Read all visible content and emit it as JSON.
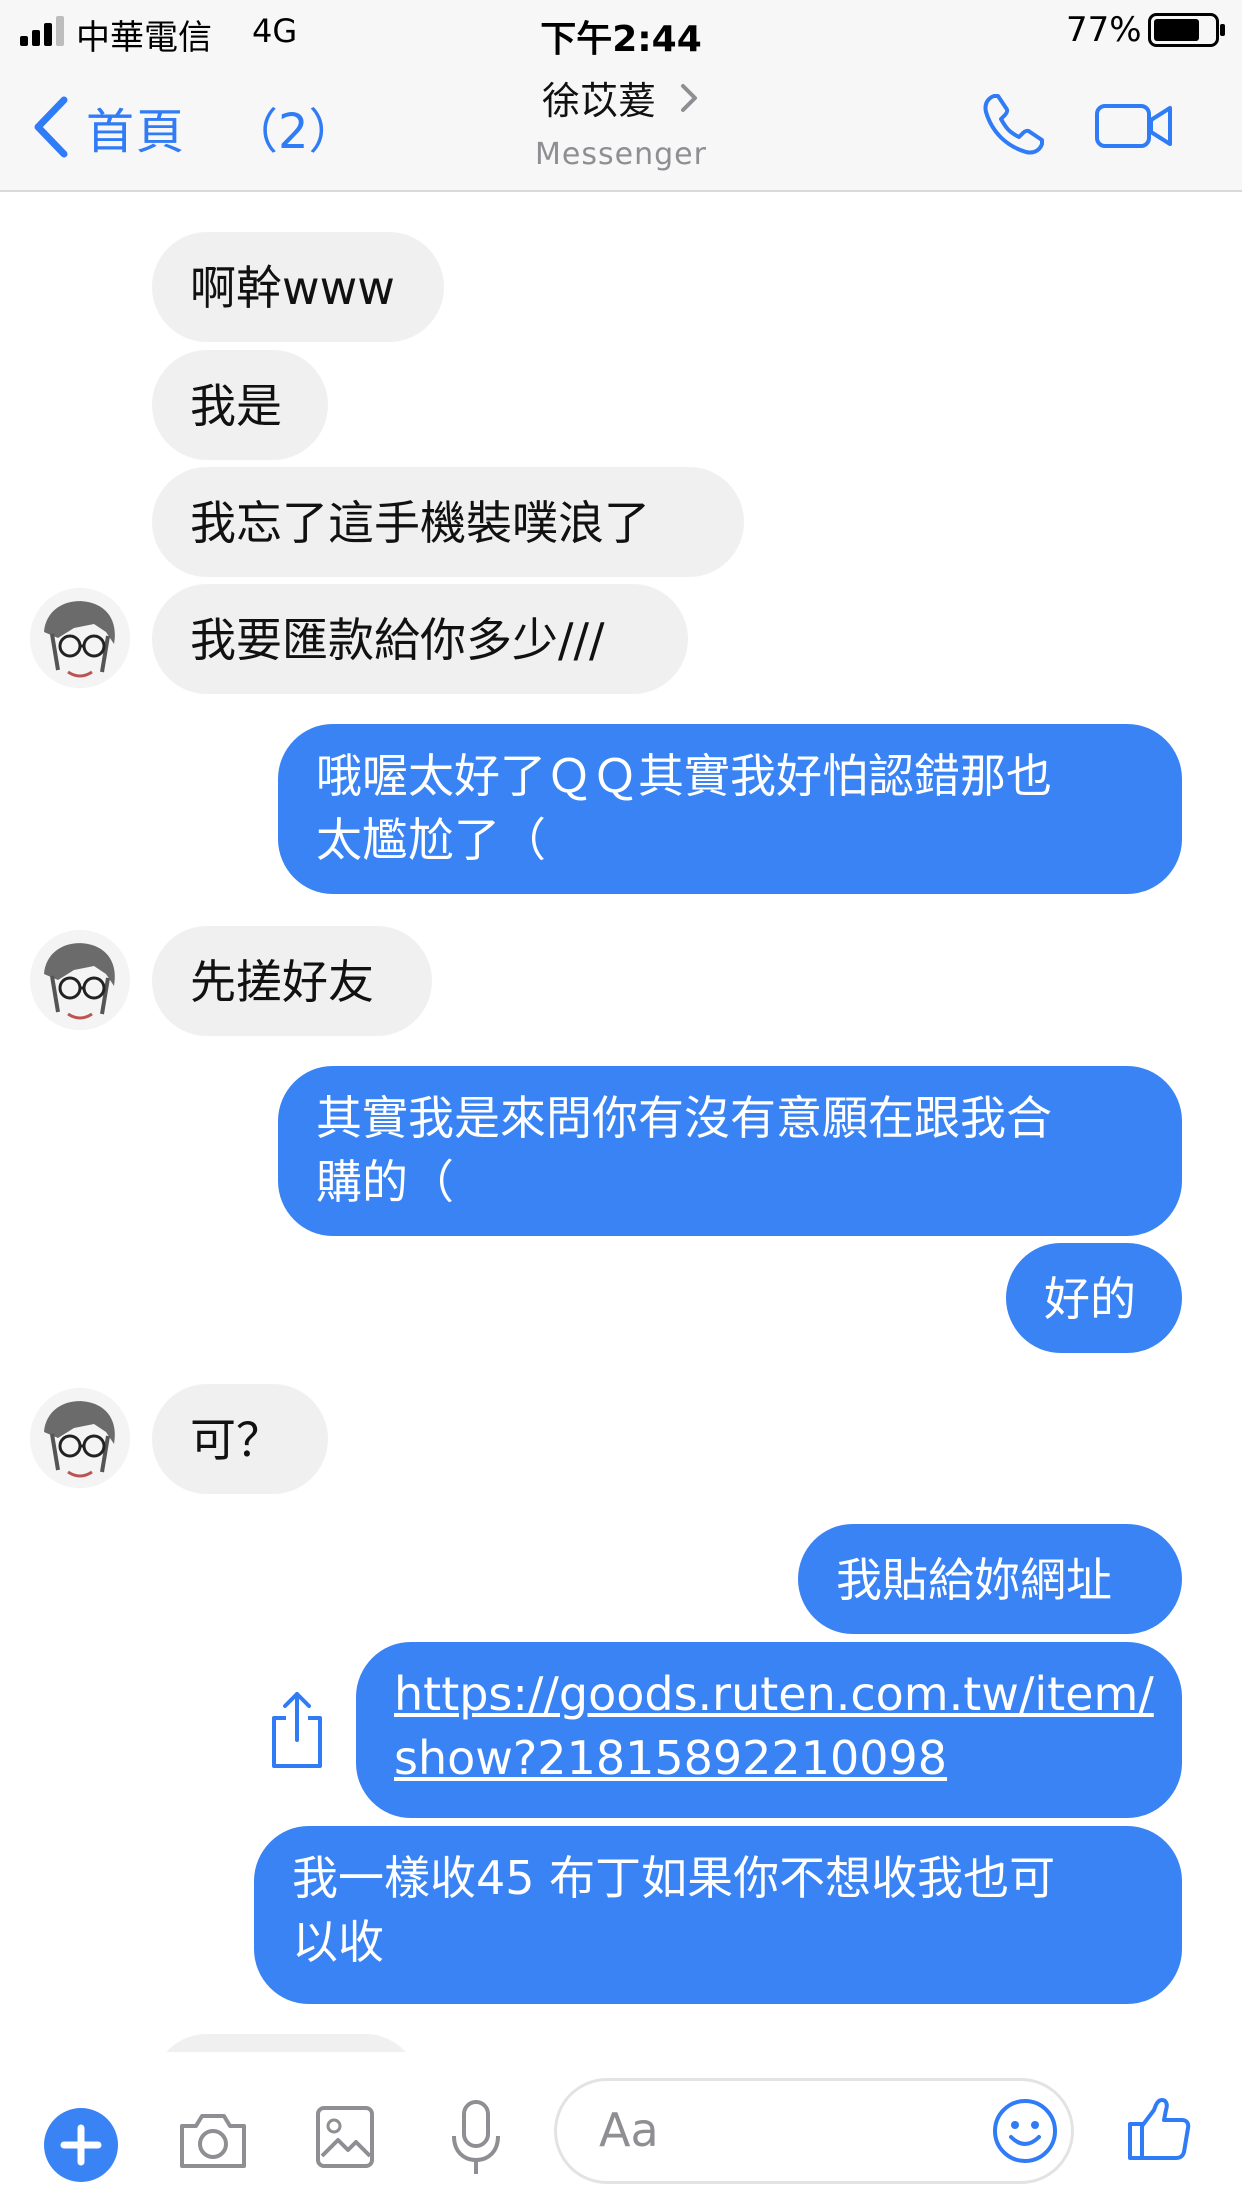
{
  "status_bar": {
    "carrier": "中華電信",
    "network": "4G",
    "time": "下午2:44",
    "battery_percent": "77%",
    "battery_level": 0.77
  },
  "header": {
    "back_label": "首頁",
    "back_count": "（2）",
    "contact_name": "徐苡萲",
    "subtitle": "Messenger",
    "icons": [
      "chevron-left-icon",
      "chevron-right-icon",
      "phone-icon",
      "video-camera-icon"
    ]
  },
  "messages": [
    {
      "sender": "contact",
      "text": "啊幹www"
    },
    {
      "sender": "contact",
      "text": "我是"
    },
    {
      "sender": "contact",
      "text": "我忘了這手機裝噗浪了"
    },
    {
      "sender": "contact",
      "text": "我要匯款給你多少///"
    },
    {
      "sender": "me",
      "lines": [
        "哦喔太好了ＱＱ其實我好怕認錯那也",
        "太尷尬了（"
      ]
    },
    {
      "sender": "contact",
      "text": "先搓好友"
    },
    {
      "sender": "me",
      "lines": [
        "其實我是來問你有沒有意願在跟我合",
        "購的（"
      ]
    },
    {
      "sender": "me",
      "text": "好的"
    },
    {
      "sender": "contact",
      "text": "可？"
    },
    {
      "sender": "me",
      "text": "我貼給妳網址"
    },
    {
      "sender": "me",
      "lines": [
        "https://goods.ruten.com.tw/item/",
        "show?21815892210098"
      ],
      "is_link": true
    },
    {
      "sender": "me",
      "lines": [
        "我一樣收45 布丁如果你不想收我也可",
        "以收"
      ]
    }
  ],
  "composer": {
    "placeholder": "Aa",
    "icons": [
      "plus-icon",
      "camera-icon",
      "image-icon",
      "microphone-icon",
      "emoji-icon",
      "thumbs-up-icon"
    ]
  },
  "colors": {
    "accent": "#3983f5",
    "incoming_bubble": "#f0f0f0",
    "header_bg": "#f7f7f7"
  }
}
